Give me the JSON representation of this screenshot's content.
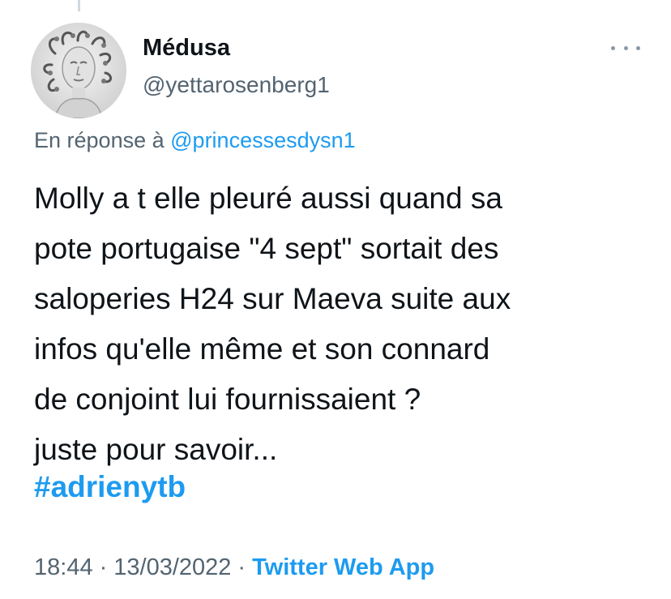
{
  "tweet": {
    "author": {
      "display_name": "Médusa",
      "handle": "@yettarosenberg1",
      "avatar_icon": "medusa-statue-avatar"
    },
    "more_icon": "more-options-icon",
    "reply_prefix": "En réponse à",
    "reply_to": "@princessesdysn1",
    "text_lines": [
      "Molly a t elle pleuré aussi quand sa",
      "pote portugaise \"4 sept\" sortait des",
      "saloperies H24 sur Maeva suite aux",
      "infos qu'elle même et son connard",
      "de conjoint lui fournissaient ?",
      "juste pour savoir..."
    ],
    "hashtag": "#adrienytb",
    "time": "18:44",
    "separator": "·",
    "date": "13/03/2022",
    "source": "Twitter Web App"
  },
  "colors": {
    "link": "#1d9bf0",
    "secondary_text": "#536471",
    "primary_text": "#0f1419"
  }
}
